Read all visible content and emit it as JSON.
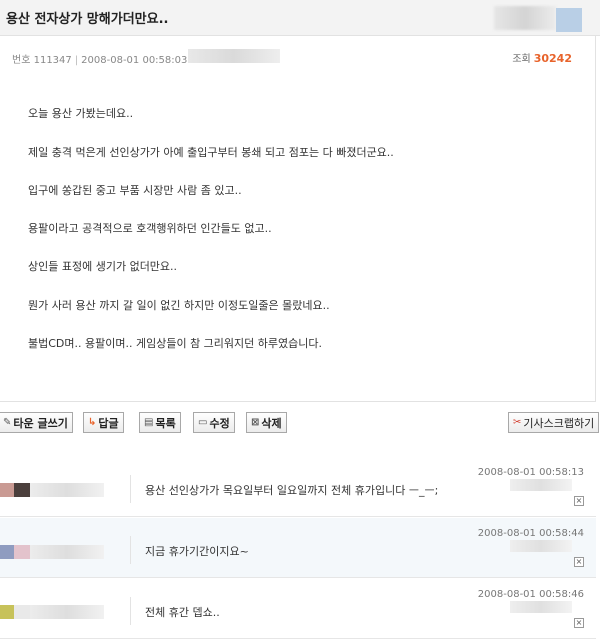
{
  "post": {
    "title": "용산 전자상가 망해가더만요..",
    "number_label": "번호",
    "number": "111347",
    "date": "2008-08-01 00:58:03",
    "views_label": "조회",
    "views": "30242",
    "lines": [
      "오늘 용산 가봤는데요..",
      "제일 충격 먹은게 선인상가가 아예 출입구부터 봉쇄 되고 점포는 다 빠졌더군요..",
      "입구에 쏭갑된 중고 부품 시장만 사람 좀 있고..",
      "용팔이라고 공격적으로 호객행위하던 인간들도 없고..",
      "상인들 표정에 생기가 없더만요..",
      "뭔가 사러 용산 까지 갈 일이 없긴 하지만 이정도일줄은 몰랐네요..",
      "불법CD며.. 용팔이며.. 게임상들이 참 그리워지던 하루였습니다."
    ]
  },
  "toolbar": {
    "write_label": "타운 글쓰기",
    "reply_label": "답글",
    "list_label": "목록",
    "edit_label": "수정",
    "delete_label": "삭제",
    "scrap_label": "기사스크랩하기"
  },
  "comments": [
    {
      "text": "용산 선인상가가 목요일부터 일요일까지 전체 휴가입니다 ㅡ_ㅡ;",
      "date": "2008-08-01 00:58:13",
      "avatar_colors": [
        "#c99a93",
        "#4b3f3c"
      ]
    },
    {
      "text": "지금 휴가기간이지요~",
      "date": "2008-08-01 00:58:44",
      "avatar_colors": [
        "#8f9cc0",
        "#e3c3cc"
      ]
    },
    {
      "text": "전체 휴간 뎁쇼..",
      "date": "2008-08-01 00:58:46",
      "avatar_colors": [
        "#c7c25a",
        "#e9e9e9"
      ]
    }
  ],
  "icons": {
    "write": "pencil-icon",
    "reply": "reply-arrow-icon",
    "list": "list-icon",
    "edit": "edit-icon",
    "delete": "delete-x-icon",
    "scrap": "scissors-icon",
    "comment_delete": "delete-x-icon"
  },
  "colors": {
    "views_accent": "#e8632b",
    "title_bar_bg": "#f3f3f3",
    "alt_row_bg": "#f4f8fb"
  }
}
